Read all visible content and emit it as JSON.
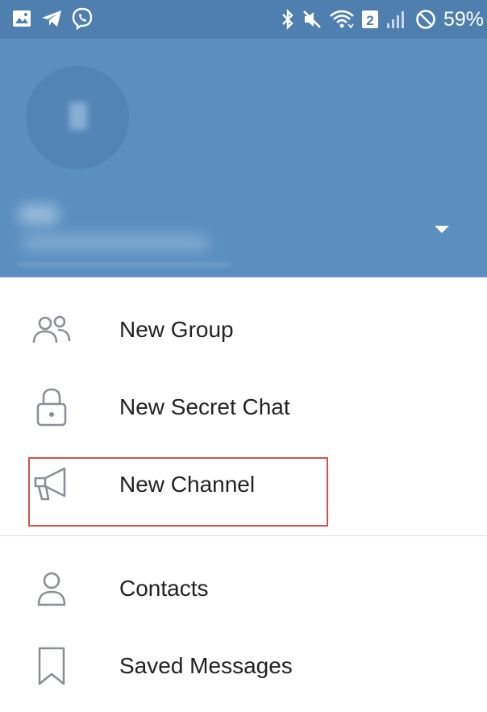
{
  "status_bar": {
    "battery_percent": "59%",
    "signal_badge": "2",
    "icons_left": [
      "gallery-icon",
      "telegram-icon",
      "viber-icon"
    ],
    "icons_right": [
      "bluetooth-icon",
      "mute-icon",
      "wifi-icon",
      "signal-icon",
      "do-not-disturb-icon"
    ]
  },
  "header": {
    "background_color": "#5b8fc0",
    "status_color": "#4f7fae"
  },
  "menu": {
    "items": [
      {
        "label": "New Group",
        "icon": "group-icon"
      },
      {
        "label": "New Secret Chat",
        "icon": "lock-icon"
      },
      {
        "label": "New Channel",
        "icon": "megaphone-icon"
      },
      {
        "label": "Contacts",
        "icon": "person-icon"
      },
      {
        "label": "Saved Messages",
        "icon": "bookmark-icon"
      }
    ],
    "highlighted_item": "New Channel",
    "highlight_color": "#d0524d"
  }
}
